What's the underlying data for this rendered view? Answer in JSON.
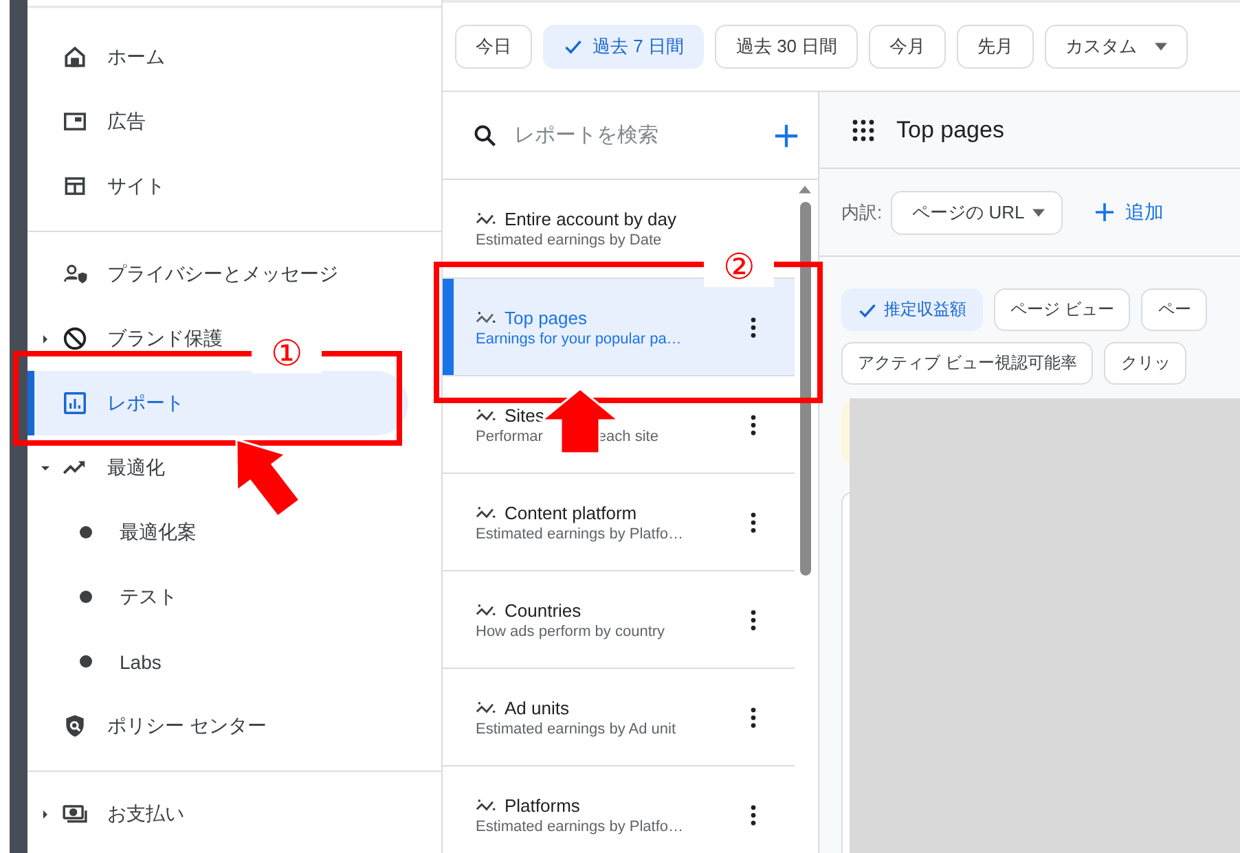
{
  "sidebar": {
    "groups": [
      [
        {
          "label": "ホーム",
          "selected": false
        },
        {
          "label": "広告",
          "selected": false
        },
        {
          "label": "サイト",
          "selected": false
        }
      ],
      [
        {
          "label": "プライバシーとメッセージ",
          "selected": false
        },
        {
          "label": "ブランド保護",
          "selected": false,
          "expanded": false
        },
        {
          "label": "レポート",
          "selected": true
        },
        {
          "label": "最適化",
          "selected": false,
          "expanded": true,
          "children": [
            {
              "label": "最適化案"
            },
            {
              "label": "テスト"
            },
            {
              "label": "Labs"
            }
          ]
        },
        {
          "label": "ポリシー センター",
          "selected": false
        }
      ],
      [
        {
          "label": "お支払い",
          "selected": false,
          "expanded": false
        }
      ]
    ]
  },
  "date_ranges": [
    {
      "label": "今日",
      "selected": false
    },
    {
      "label": "過去 7 日間",
      "selected": true
    },
    {
      "label": "過去 30 日間",
      "selected": false
    },
    {
      "label": "今月",
      "selected": false
    },
    {
      "label": "先月",
      "selected": false
    },
    {
      "label": "カスタム",
      "selected": false,
      "dropdown": true
    }
  ],
  "reports": {
    "search": {
      "placeholder": "レポートを検索"
    },
    "items": [
      {
        "title": "Entire account by day",
        "description_parts": [
          "Estimated earnings by Date"
        ],
        "selected": false,
        "menu": false
      },
      {
        "title": "Top pages",
        "description_parts": [
          "Earnings for your popular pa…"
        ],
        "selected": true,
        "menu": true
      },
      {
        "title": "Sites",
        "description_parts": [
          "Performar",
          "each site"
        ],
        "selected": false,
        "menu": true
      },
      {
        "title": "Content platform",
        "description_parts": [
          "Estimated earnings by Platfo…"
        ],
        "selected": false,
        "menu": true
      },
      {
        "title": "Countries",
        "description_parts": [
          "How ads perform by country"
        ],
        "selected": false,
        "menu": true
      },
      {
        "title": "Ad units",
        "description_parts": [
          "Estimated earnings by Ad unit"
        ],
        "selected": false,
        "menu": true
      },
      {
        "title": "Platforms",
        "description_parts": [
          "Estimated earnings by Platfo…"
        ],
        "selected": false,
        "menu": true
      }
    ]
  },
  "detail": {
    "title": "Top pages",
    "breakdown_label": "内訳:",
    "breakdown_value": "ページの URL",
    "add_button": "追加",
    "metrics": [
      [
        {
          "label": "推定収益額",
          "selected": true
        },
        {
          "label": "ページ ビュー",
          "selected": false
        },
        {
          "label": "ペー",
          "selected": false
        }
      ],
      [
        {
          "label": "アクティブ ビュー視認可能率",
          "selected": false
        },
        {
          "label": "クリッ",
          "selected": false
        }
      ]
    ]
  },
  "annotations": [
    {
      "label": "①"
    },
    {
      "label": "②"
    }
  ]
}
